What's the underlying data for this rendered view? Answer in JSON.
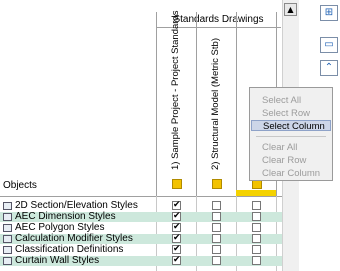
{
  "objects_header": "Objects",
  "group_header": "Standards Drawings",
  "columns": [
    {
      "label": "1) Sample Project - Project Standards"
    },
    {
      "label": "2) Structural Model (Metric Stb)"
    },
    {
      "label": ""
    }
  ],
  "rows": [
    {
      "icon": "section-elevation-icon",
      "label": "2D Section/Elevation Styles",
      "checks": [
        true,
        false,
        false
      ]
    },
    {
      "icon": "dimension-icon",
      "label": "AEC Dimension Styles",
      "checks": [
        true,
        false,
        false
      ]
    },
    {
      "icon": "polygon-icon",
      "label": "AEC Polygon Styles",
      "checks": [
        true,
        false,
        false
      ]
    },
    {
      "icon": "calculation-modifier-icon",
      "label": "Calculation Modifier Styles",
      "checks": [
        true,
        false,
        false
      ]
    },
    {
      "icon": "classification-icon",
      "label": "Classification Definitions",
      "checks": [
        true,
        false,
        false
      ]
    },
    {
      "icon": "curtain-wall-icon",
      "label": "Curtain Wall Styles",
      "checks": [
        true,
        false,
        false
      ]
    }
  ],
  "context_menu": {
    "items": [
      "Select All",
      "Select Row",
      "Select Column",
      "Clear All",
      "Clear Row",
      "Clear Column"
    ],
    "active": "Select Column"
  },
  "icons": {
    "scroll_up": "scroll-up-icon",
    "side_buttons": [
      "add-drawing-icon",
      "remove-drawing-icon",
      "move-up-icon"
    ]
  },
  "colors": {
    "row_highlight": "#cde8dc",
    "column_highlight": "#f4d200",
    "menu_active": "#cdd6e8"
  }
}
